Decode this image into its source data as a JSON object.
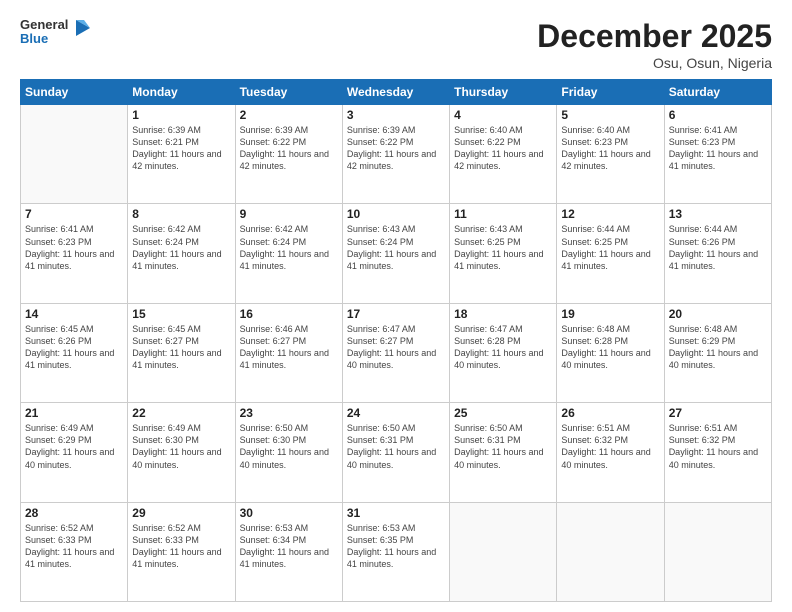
{
  "header": {
    "logo_general": "General",
    "logo_blue": "Blue",
    "month_title": "December 2025",
    "location": "Osu, Osun, Nigeria"
  },
  "weekdays": [
    "Sunday",
    "Monday",
    "Tuesday",
    "Wednesday",
    "Thursday",
    "Friday",
    "Saturday"
  ],
  "weeks": [
    [
      {
        "day": "",
        "info": ""
      },
      {
        "day": "1",
        "info": "Sunrise: 6:39 AM\nSunset: 6:21 PM\nDaylight: 11 hours\nand 42 minutes."
      },
      {
        "day": "2",
        "info": "Sunrise: 6:39 AM\nSunset: 6:22 PM\nDaylight: 11 hours\nand 42 minutes."
      },
      {
        "day": "3",
        "info": "Sunrise: 6:39 AM\nSunset: 6:22 PM\nDaylight: 11 hours\nand 42 minutes."
      },
      {
        "day": "4",
        "info": "Sunrise: 6:40 AM\nSunset: 6:22 PM\nDaylight: 11 hours\nand 42 minutes."
      },
      {
        "day": "5",
        "info": "Sunrise: 6:40 AM\nSunset: 6:23 PM\nDaylight: 11 hours\nand 42 minutes."
      },
      {
        "day": "6",
        "info": "Sunrise: 6:41 AM\nSunset: 6:23 PM\nDaylight: 11 hours\nand 41 minutes."
      }
    ],
    [
      {
        "day": "7",
        "info": "Sunrise: 6:41 AM\nSunset: 6:23 PM\nDaylight: 11 hours\nand 41 minutes."
      },
      {
        "day": "8",
        "info": "Sunrise: 6:42 AM\nSunset: 6:24 PM\nDaylight: 11 hours\nand 41 minutes."
      },
      {
        "day": "9",
        "info": "Sunrise: 6:42 AM\nSunset: 6:24 PM\nDaylight: 11 hours\nand 41 minutes."
      },
      {
        "day": "10",
        "info": "Sunrise: 6:43 AM\nSunset: 6:24 PM\nDaylight: 11 hours\nand 41 minutes."
      },
      {
        "day": "11",
        "info": "Sunrise: 6:43 AM\nSunset: 6:25 PM\nDaylight: 11 hours\nand 41 minutes."
      },
      {
        "day": "12",
        "info": "Sunrise: 6:44 AM\nSunset: 6:25 PM\nDaylight: 11 hours\nand 41 minutes."
      },
      {
        "day": "13",
        "info": "Sunrise: 6:44 AM\nSunset: 6:26 PM\nDaylight: 11 hours\nand 41 minutes."
      }
    ],
    [
      {
        "day": "14",
        "info": "Sunrise: 6:45 AM\nSunset: 6:26 PM\nDaylight: 11 hours\nand 41 minutes."
      },
      {
        "day": "15",
        "info": "Sunrise: 6:45 AM\nSunset: 6:27 PM\nDaylight: 11 hours\nand 41 minutes."
      },
      {
        "day": "16",
        "info": "Sunrise: 6:46 AM\nSunset: 6:27 PM\nDaylight: 11 hours\nand 41 minutes."
      },
      {
        "day": "17",
        "info": "Sunrise: 6:47 AM\nSunset: 6:27 PM\nDaylight: 11 hours\nand 40 minutes."
      },
      {
        "day": "18",
        "info": "Sunrise: 6:47 AM\nSunset: 6:28 PM\nDaylight: 11 hours\nand 40 minutes."
      },
      {
        "day": "19",
        "info": "Sunrise: 6:48 AM\nSunset: 6:28 PM\nDaylight: 11 hours\nand 40 minutes."
      },
      {
        "day": "20",
        "info": "Sunrise: 6:48 AM\nSunset: 6:29 PM\nDaylight: 11 hours\nand 40 minutes."
      }
    ],
    [
      {
        "day": "21",
        "info": "Sunrise: 6:49 AM\nSunset: 6:29 PM\nDaylight: 11 hours\nand 40 minutes."
      },
      {
        "day": "22",
        "info": "Sunrise: 6:49 AM\nSunset: 6:30 PM\nDaylight: 11 hours\nand 40 minutes."
      },
      {
        "day": "23",
        "info": "Sunrise: 6:50 AM\nSunset: 6:30 PM\nDaylight: 11 hours\nand 40 minutes."
      },
      {
        "day": "24",
        "info": "Sunrise: 6:50 AM\nSunset: 6:31 PM\nDaylight: 11 hours\nand 40 minutes."
      },
      {
        "day": "25",
        "info": "Sunrise: 6:50 AM\nSunset: 6:31 PM\nDaylight: 11 hours\nand 40 minutes."
      },
      {
        "day": "26",
        "info": "Sunrise: 6:51 AM\nSunset: 6:32 PM\nDaylight: 11 hours\nand 40 minutes."
      },
      {
        "day": "27",
        "info": "Sunrise: 6:51 AM\nSunset: 6:32 PM\nDaylight: 11 hours\nand 40 minutes."
      }
    ],
    [
      {
        "day": "28",
        "info": "Sunrise: 6:52 AM\nSunset: 6:33 PM\nDaylight: 11 hours\nand 41 minutes."
      },
      {
        "day": "29",
        "info": "Sunrise: 6:52 AM\nSunset: 6:33 PM\nDaylight: 11 hours\nand 41 minutes."
      },
      {
        "day": "30",
        "info": "Sunrise: 6:53 AM\nSunset: 6:34 PM\nDaylight: 11 hours\nand 41 minutes."
      },
      {
        "day": "31",
        "info": "Sunrise: 6:53 AM\nSunset: 6:35 PM\nDaylight: 11 hours\nand 41 minutes."
      },
      {
        "day": "",
        "info": ""
      },
      {
        "day": "",
        "info": ""
      },
      {
        "day": "",
        "info": ""
      }
    ]
  ]
}
